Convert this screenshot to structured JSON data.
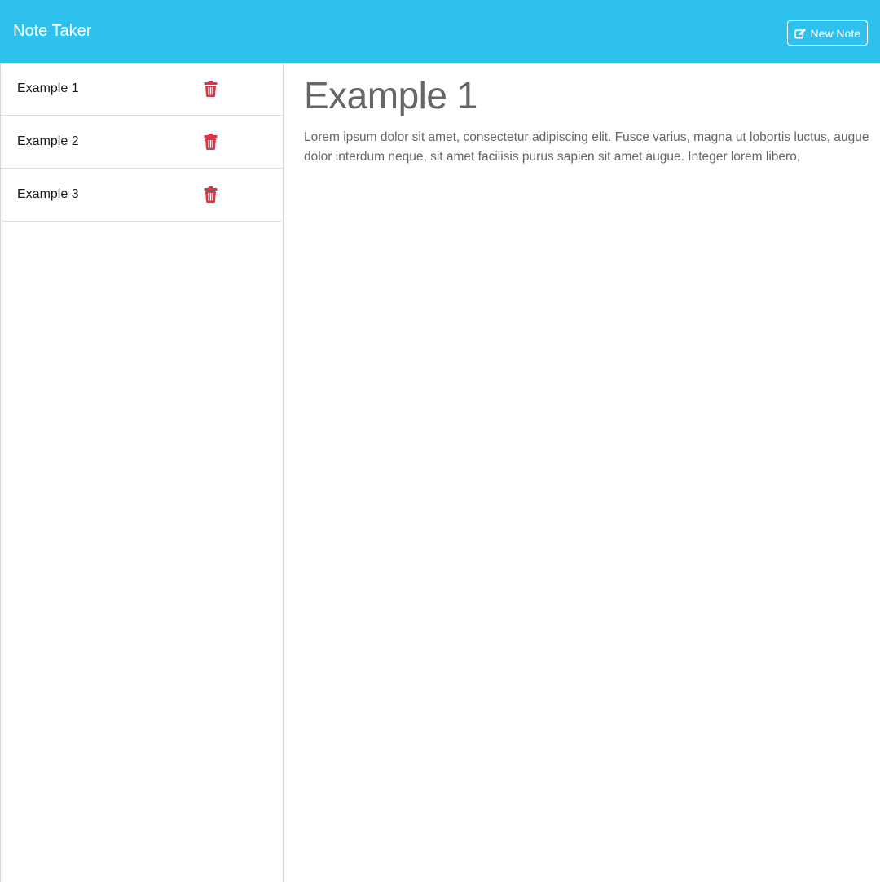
{
  "app": {
    "title": "Note Taker"
  },
  "toolbar": {
    "new_note_label": "New Note",
    "new_note_icon": "edit-icon"
  },
  "sidebar": {
    "notes": [
      {
        "title": "Example 1"
      },
      {
        "title": "Example 2"
      },
      {
        "title": "Example 3"
      }
    ],
    "delete_icon": "trash-icon",
    "delete_color": "#dc3545"
  },
  "main": {
    "note_title": "Example 1",
    "note_text": "Lorem ipsum dolor sit amet, consectetur adipiscing elit. Fusce varius, magna ut lobortis luctus, augue dolor interdum neque, sit amet facilisis purus sapien sit amet augue. Integer lorem libero,"
  },
  "colors": {
    "navbar": "#2ec1ee",
    "text_muted": "#666666"
  }
}
